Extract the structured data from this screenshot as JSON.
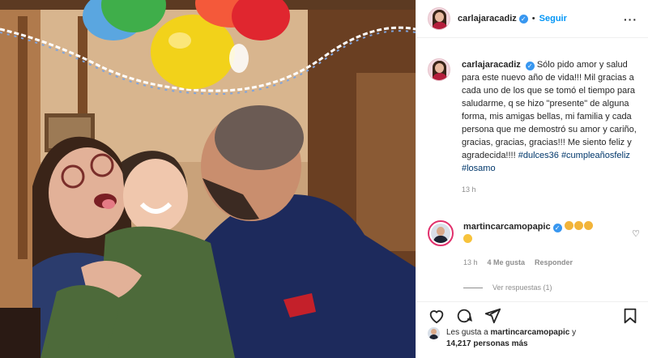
{
  "header": {
    "username": "carlajaracadiz",
    "verified_icon": "verified-badge-icon",
    "separator": "•",
    "follow_label": "Seguir",
    "more_icon": "more-options-icon",
    "more_glyph": "···"
  },
  "caption": {
    "username": "carlajaracadiz",
    "text": "Sólo pido amor y salud para este nuevo año de vida!!! Mil gracias a cada uno de los que se tomó el tiempo para saludarme, q se hizo \"presente\" de alguna forma, mis amigas bellas, mi familia y cada persona que me demostró su amor y cariño, gracias, gracias, gracias!!! Me siento feliz y agradecida!!!! ",
    "hashtags": [
      "#dulces36",
      "#cumpleañosfeliz",
      "#losamo"
    ],
    "time": "13 h"
  },
  "comment": {
    "username": "martincarcamopapic",
    "emojis": [
      "clapping-hands",
      "clapping-hands",
      "clapping-hands",
      "star-struck"
    ],
    "time": "13 h",
    "likes": "4 Me gusta",
    "reply_label": "Responder",
    "heart_glyph": "♡",
    "view_replies": "Ver respuestas (1)"
  },
  "actions": {
    "like_icon": "heart-icon",
    "comment_icon": "comment-icon",
    "share_icon": "share-icon",
    "save_icon": "bookmark-icon"
  },
  "likes": {
    "prefix": "Les gusta a",
    "user": "martincarcamopapic",
    "connector": "y",
    "count": "14,217 personas más"
  },
  "colors": {
    "link_blue": "#0095f6",
    "hashtag": "#00376b",
    "muted": "#8e8e8e",
    "verified": "#3897f0"
  }
}
